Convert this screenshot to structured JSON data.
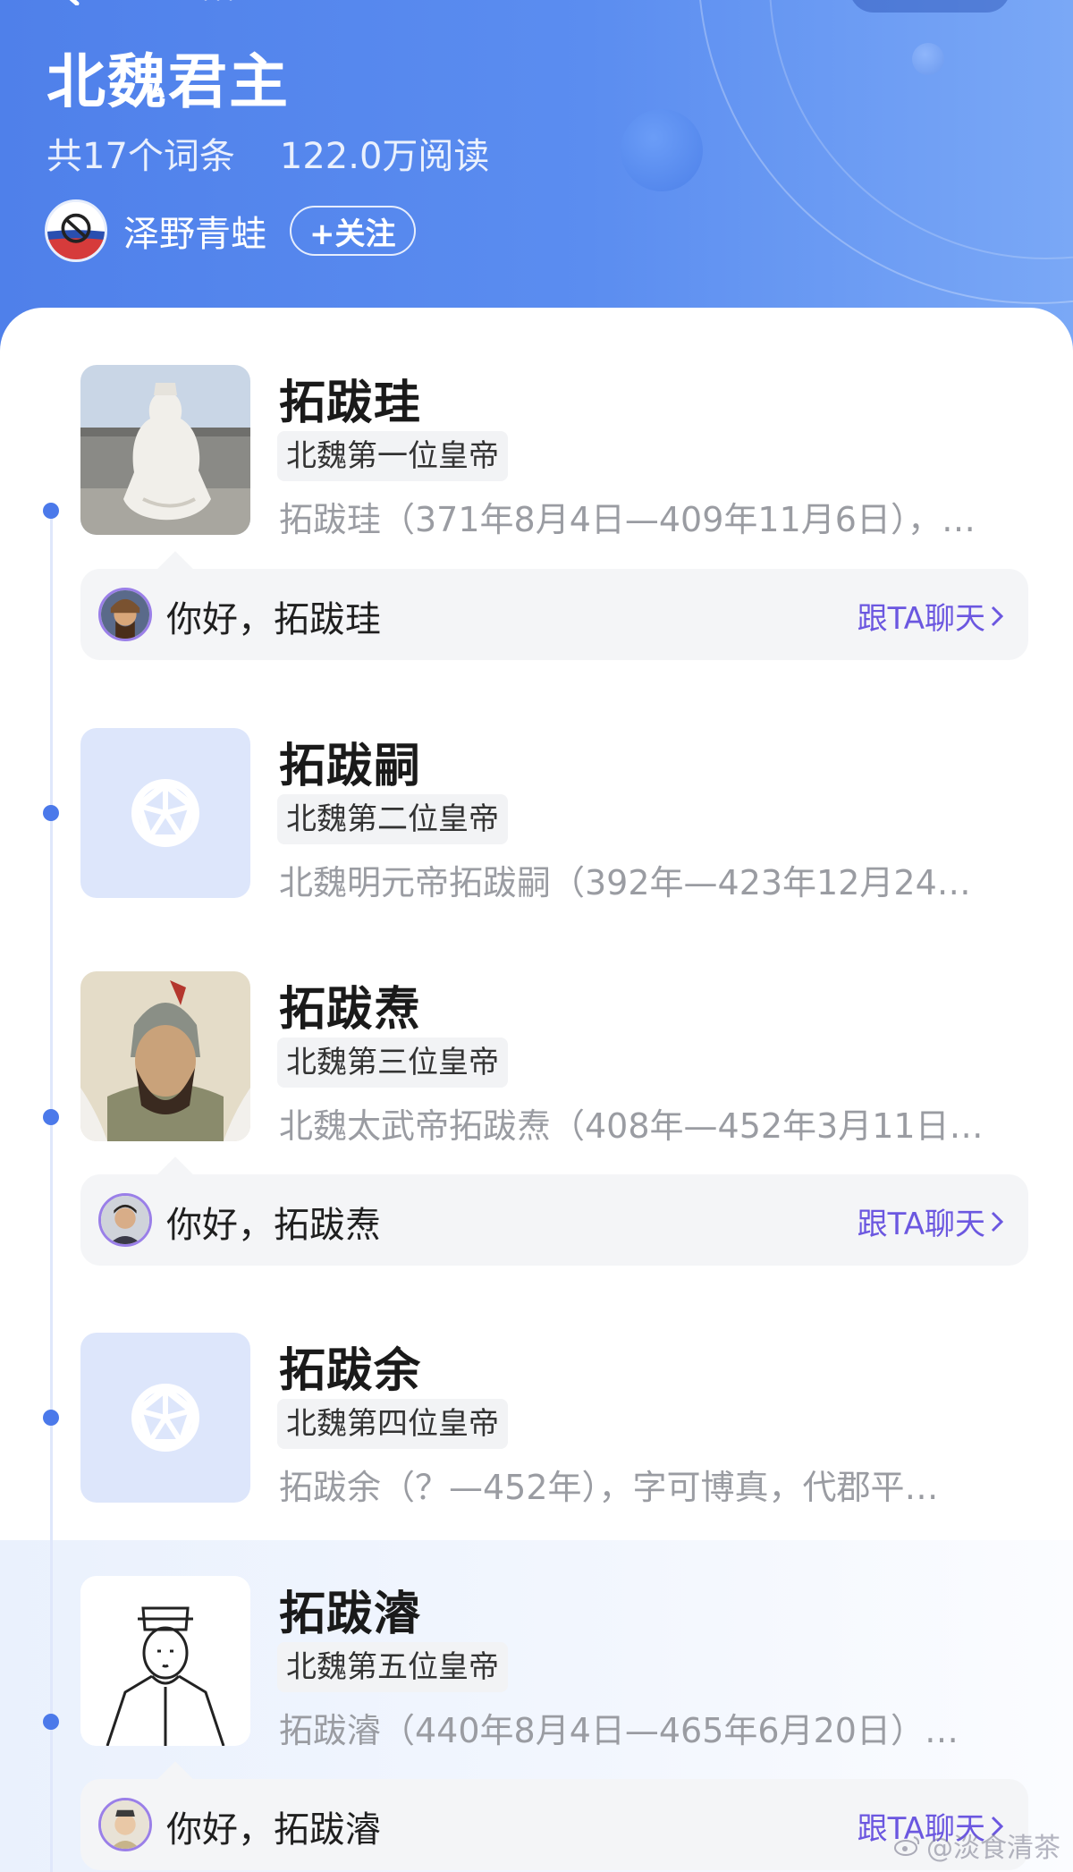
{
  "header": {
    "title": "北魏君主",
    "entry_count": "共17个词条",
    "reads": "122.0万阅读",
    "author": "泽野青蛙",
    "follow_label": "+关注"
  },
  "entries": [
    {
      "name": "拓跋珪",
      "tag": "北魏第一位皇帝",
      "desc": "拓跋珪（371年8月4日—409年11月6日），…",
      "thumb": "photo-statue",
      "chat": {
        "greeting": "你好，拓跋珪",
        "link": "跟TA聊天"
      }
    },
    {
      "name": "拓跋嗣",
      "tag": "北魏第二位皇帝",
      "desc": "北魏明元帝拓跋嗣（392年—423年12月24…",
      "thumb": "placeholder-icon"
    },
    {
      "name": "拓跋焘",
      "tag": "北魏第三位皇帝",
      "desc": "北魏太武帝拓跋焘（408年—452年3月11日…",
      "thumb": "painting-portrait",
      "chat": {
        "greeting": "你好，拓跋焘",
        "link": "跟TA聊天"
      }
    },
    {
      "name": "拓跋余",
      "tag": "北魏第四位皇帝",
      "desc": "拓跋余（？—452年），字可博真，代郡平…",
      "thumb": "placeholder-icon"
    },
    {
      "name": "拓跋濬",
      "tag": "北魏第五位皇帝",
      "desc": "拓跋濬（440年8月4日—465年6月20日）…",
      "thumb": "line-drawing",
      "chat": {
        "greeting": "你好，拓跋濬",
        "link": "跟TA聊天"
      }
    }
  ],
  "watermark": "@淡食清茶",
  "colors": {
    "header_blue": "#5b8df0",
    "timeline_dot": "#4b79ea",
    "chat_link": "#6b57e0",
    "tag_bg": "#f2f3f5"
  }
}
